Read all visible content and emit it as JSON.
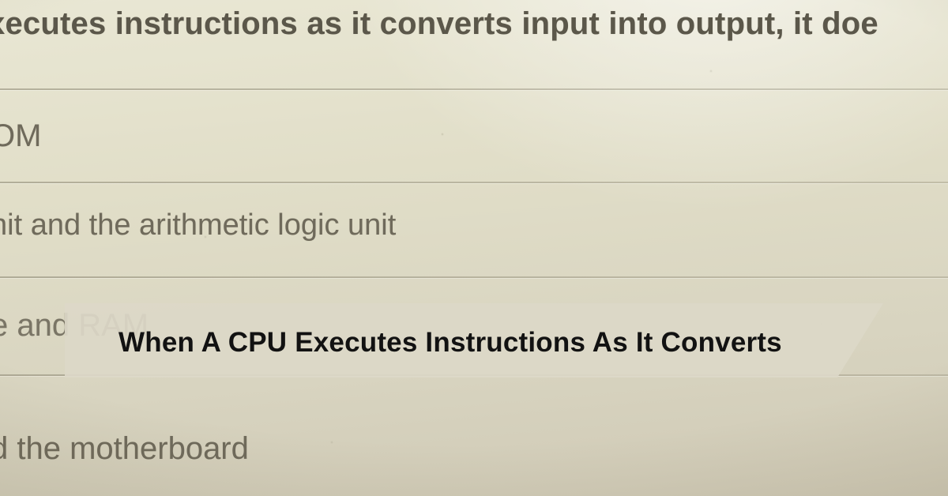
{
  "question": "xecutes instructions as it converts input into output, it doe",
  "options": {
    "a": "OM",
    "b": "nit and the arithmetic logic unit",
    "c": "e and RAM",
    "d": "d the motherboard"
  },
  "banner": {
    "title": "When A CPU Executes Instructions As It Converts"
  }
}
